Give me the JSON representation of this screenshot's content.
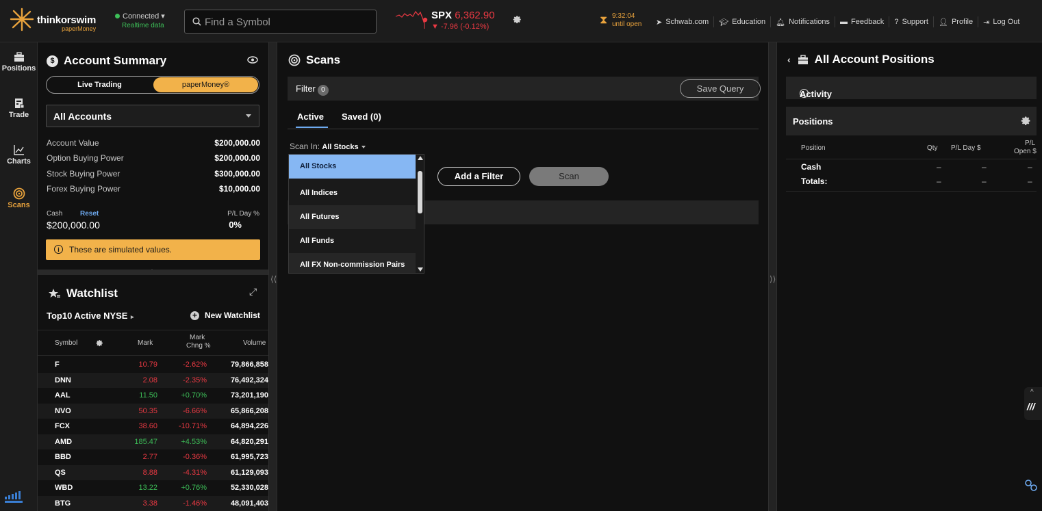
{
  "app": {
    "brand": "thinkorswim",
    "subbrand": "paperMoney",
    "connection_status": "Connected",
    "connection_detail": "Realtime data"
  },
  "search": {
    "placeholder": "Find a Symbol"
  },
  "ticker": {
    "symbol": "SPX",
    "price": "6,362.90",
    "change": "-7.96 (-0.12%)"
  },
  "market_clock": {
    "time": "9:32:04",
    "label": "until open"
  },
  "top_links": [
    "Schwab.com",
    "Education",
    "Notifications",
    "Feedback",
    "Support",
    "Profile",
    "Log Out"
  ],
  "nav": [
    {
      "label": "Positions",
      "icon": "briefcase-icon"
    },
    {
      "label": "Trade",
      "icon": "trade-icon"
    },
    {
      "label": "Charts",
      "icon": "chart-line-icon"
    },
    {
      "label": "Scans",
      "icon": "scan-target-icon",
      "active": true
    }
  ],
  "account_summary": {
    "title": "Account Summary",
    "segment_live": "Live Trading",
    "segment_paper": "paperMoney®",
    "selected_account": "All Accounts",
    "rows": [
      {
        "label": "Account Value",
        "value": "$200,000.00"
      },
      {
        "label": "Option Buying Power",
        "value": "$200,000.00"
      },
      {
        "label": "Stock Buying Power",
        "value": "$300,000.00"
      },
      {
        "label": "Forex Buying Power",
        "value": "$10,000.00"
      }
    ],
    "cash_label": "Cash",
    "reset_label": "Reset",
    "cash_value": "$200,000.00",
    "pl_label": "P/L Day %",
    "pl_value": "0%",
    "notice": "These are simulated values."
  },
  "watchlist": {
    "title": "Watchlist",
    "list_name": "Top10 Active NYSE",
    "new_label": "New Watchlist",
    "columns": {
      "symbol": "Symbol",
      "mark": "Mark",
      "mark_chng_1": "Mark",
      "mark_chng_2": "Chng %",
      "volume": "Volume"
    },
    "rows": [
      {
        "symbol": "F",
        "mark": "10.79",
        "chg": "-2.62%",
        "volume": "79,866,858",
        "dir": "neg"
      },
      {
        "symbol": "DNN",
        "mark": "2.08",
        "chg": "-2.35%",
        "volume": "76,492,324",
        "dir": "neg"
      },
      {
        "symbol": "AAL",
        "mark": "11.50",
        "chg": "+0.70%",
        "volume": "73,201,190",
        "dir": "pos"
      },
      {
        "symbol": "NVO",
        "mark": "50.35",
        "chg": "-6.66%",
        "volume": "65,866,208",
        "dir": "neg"
      },
      {
        "symbol": "FCX",
        "mark": "38.60",
        "chg": "-10.71%",
        "volume": "64,894,226",
        "dir": "neg"
      },
      {
        "symbol": "AMD",
        "mark": "185.47",
        "chg": "+4.53%",
        "volume": "64,820,291",
        "dir": "pos"
      },
      {
        "symbol": "BBD",
        "mark": "2.77",
        "chg": "-0.36%",
        "volume": "61,995,723",
        "dir": "neg"
      },
      {
        "symbol": "QS",
        "mark": "8.88",
        "chg": "-4.31%",
        "volume": "61,129,093",
        "dir": "neg"
      },
      {
        "symbol": "WBD",
        "mark": "13.22",
        "chg": "+0.76%",
        "volume": "52,330,028",
        "dir": "pos"
      },
      {
        "symbol": "BTG",
        "mark": "3.38",
        "chg": "-1.46%",
        "volume": "48,091,403",
        "dir": "neg"
      }
    ]
  },
  "scans": {
    "title": "Scans",
    "filter_label": "Filter",
    "filter_count": "0",
    "save_query": "Save Query",
    "tab_active": "Active",
    "tab_saved": "Saved (0)",
    "scan_in_label": "Scan In:",
    "scan_in_value": "All Stocks",
    "add_filter": "Add a Filter",
    "scan_button": "Scan",
    "dropdown_options": [
      "All Stocks",
      "All Indices",
      "All Futures",
      "All Funds",
      "All FX Non-commission Pairs"
    ],
    "dropdown_selected": "All Stocks"
  },
  "positions": {
    "title": "All Account Positions",
    "activity": "Activity",
    "section": "Positions",
    "columns": {
      "position": "Position",
      "qty": "Qty",
      "pl_day": "P/L Day $",
      "pl_open_1": "P/L",
      "pl_open_2": "Open $"
    },
    "rows": [
      {
        "label": "Cash",
        "qty": "–",
        "pl_day": "–",
        "pl_open": "–"
      },
      {
        "label": "Totals:",
        "qty": "–",
        "pl_day": "–",
        "pl_open": "–"
      }
    ]
  },
  "colors": {
    "accent_orange": "#f2b24a",
    "up_green": "#3dbf58",
    "down_red": "#ea3943",
    "link_blue": "#6eaaf0",
    "dropdown_selected": "#86b7f3"
  }
}
